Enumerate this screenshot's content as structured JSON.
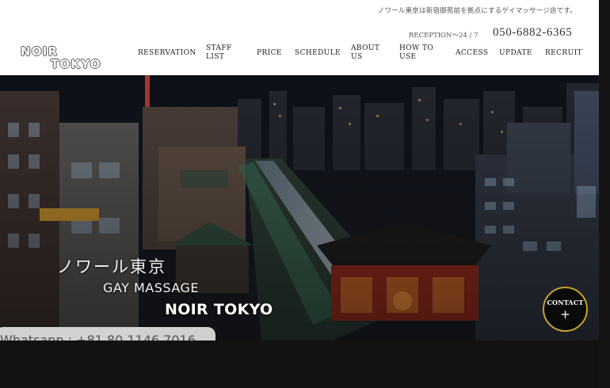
{
  "header": {
    "tagline": "ノワール東京は新宿御苑前を拠点にするゲイマッサージ店です。",
    "reception": "RECEPTION～24 / 7",
    "phone": "050-6882-6365",
    "logo": {
      "line1": "NOIR",
      "line2": "TOKYO"
    }
  },
  "nav": {
    "items": [
      {
        "label": "RESERVATION"
      },
      {
        "label": "STAFF LIST",
        "l1": "STAFF",
        "l2": "LIST"
      },
      {
        "label": "PRICE"
      },
      {
        "label": "SCHEDULE"
      },
      {
        "label": "ABOUT US",
        "l1": "ABOUT",
        "l2": "US"
      },
      {
        "label": "HOW TO USE",
        "l1": "HOW TO",
        "l2": "USE"
      },
      {
        "label": "ACCESS"
      },
      {
        "label": "UPDATE"
      },
      {
        "label": "RECRUIT"
      }
    ]
  },
  "hero": {
    "jp_title": "ノワール東京",
    "en_subtitle": "GAY MASSAGE",
    "en_title": "NOIR TOKYO",
    "whatsapp": "Whatsapp : +81 80 1146 7016"
  },
  "contact": {
    "label": "CONTACT",
    "plus": "+"
  },
  "colors": {
    "gold": "#c9a42a",
    "header_bg": "#ffffff",
    "dark_bg": "#111111"
  }
}
